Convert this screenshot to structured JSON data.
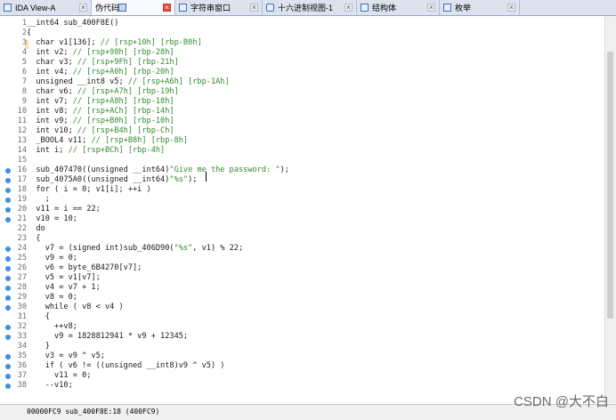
{
  "tabs": [
    {
      "label": "IDA View-A",
      "icon": "ida-view-icon",
      "active": false
    },
    {
      "label": "伪代码",
      "icon": "pseudocode-icon",
      "active": true
    },
    {
      "label": "字符串窗口",
      "icon": "strings-icon",
      "active": false
    },
    {
      "label": "十六进制视图-1",
      "icon": "hex-view-icon",
      "active": false
    },
    {
      "label": "结构体",
      "icon": "structures-icon",
      "active": false
    },
    {
      "label": "枚举",
      "icon": "enums-icon",
      "active": false
    }
  ],
  "code_lines": [
    {
      "n": "1",
      "text": "__int64 sub_400F8E()"
    },
    {
      "n": "2",
      "text": "{"
    },
    {
      "n": "3",
      "text": "  char v1[136]; // [rsp+10h] [rbp-B0h]"
    },
    {
      "n": "4",
      "text": "  int v2; // [rsp+98h] [rbp-28h]"
    },
    {
      "n": "5",
      "text": "  char v3; // [rsp+9Fh] [rbp-21h]"
    },
    {
      "n": "6",
      "text": "  int v4; // [rsp+A0h] [rbp-20h]"
    },
    {
      "n": "7",
      "text": "  unsigned __int8 v5; // [rsp+A6h] [rbp-1Ah]"
    },
    {
      "n": "8",
      "text": "  char v6; // [rsp+A7h] [rbp-19h]"
    },
    {
      "n": "9",
      "text": "  int v7; // [rsp+A8h] [rbp-18h]"
    },
    {
      "n": "10",
      "text": "  int v8; // [rsp+ACh] [rbp-14h]"
    },
    {
      "n": "11",
      "text": "  int v9; // [rsp+B0h] [rbp-10h]"
    },
    {
      "n": "12",
      "text": "  int v10; // [rsp+B4h] [rbp-Ch]"
    },
    {
      "n": "13",
      "text": "  _BOOL4 v11; // [rsp+B8h] [rbp-8h]"
    },
    {
      "n": "14",
      "text": "  int i; // [rsp+BCh] [rbp-4h]"
    },
    {
      "n": "15",
      "text": ""
    },
    {
      "n": "16",
      "text": "  sub_407470((unsigned __int64)\"Give me the password: \");"
    },
    {
      "n": "17",
      "text": "  sub_4075A0((unsigned __int64)\"%s\");"
    },
    {
      "n": "18",
      "text": "  for ( i = 0; v1[i]; ++i )"
    },
    {
      "n": "19",
      "text": "    ;"
    },
    {
      "n": "20",
      "text": "  v11 = i == 22;"
    },
    {
      "n": "21",
      "text": "  v10 = 10;"
    },
    {
      "n": "22",
      "text": "  do"
    },
    {
      "n": "23",
      "text": "  {"
    },
    {
      "n": "24",
      "text": "    v7 = (signed int)sub_406D90(\"%s\", v1) % 22;"
    },
    {
      "n": "25",
      "text": "    v9 = 0;"
    },
    {
      "n": "26",
      "text": "    v6 = byte_6B4270[v7];"
    },
    {
      "n": "27",
      "text": "    v5 = v1[v7];"
    },
    {
      "n": "28",
      "text": "    v4 = v7 + 1;"
    },
    {
      "n": "29",
      "text": "    v8 = 0;"
    },
    {
      "n": "30",
      "text": "    while ( v8 < v4 )"
    },
    {
      "n": "31",
      "text": "    {"
    },
    {
      "n": "32",
      "text": "      ++v8;"
    },
    {
      "n": "33",
      "text": "      v9 = 1828812941 * v9 + 12345;"
    },
    {
      "n": "34",
      "text": "    }"
    },
    {
      "n": "35",
      "text": "    v3 = v9 ^ v5;"
    },
    {
      "n": "36",
      "text": "    if ( v6 != ((unsigned __int8)v9 ^ v5) )"
    },
    {
      "n": "37",
      "text": "      v11 = 0;"
    },
    {
      "n": "38",
      "text": "    --v10;"
    }
  ],
  "breakpoint_lines": [
    "16",
    "17",
    "18",
    "19",
    "20",
    "21",
    "24",
    "25",
    "26",
    "27",
    "28",
    "29",
    "30",
    "32",
    "33",
    "35",
    "36",
    "37",
    "38"
  ],
  "status": {
    "text": "00000FC9 sub_400F8E:18 (400FC9)"
  },
  "watermark": "CSDN @大不白",
  "colors": {
    "comment": "#2f8a2f",
    "tab_active_close": "#e4513a",
    "breakpoint": "#3a8fe0"
  }
}
